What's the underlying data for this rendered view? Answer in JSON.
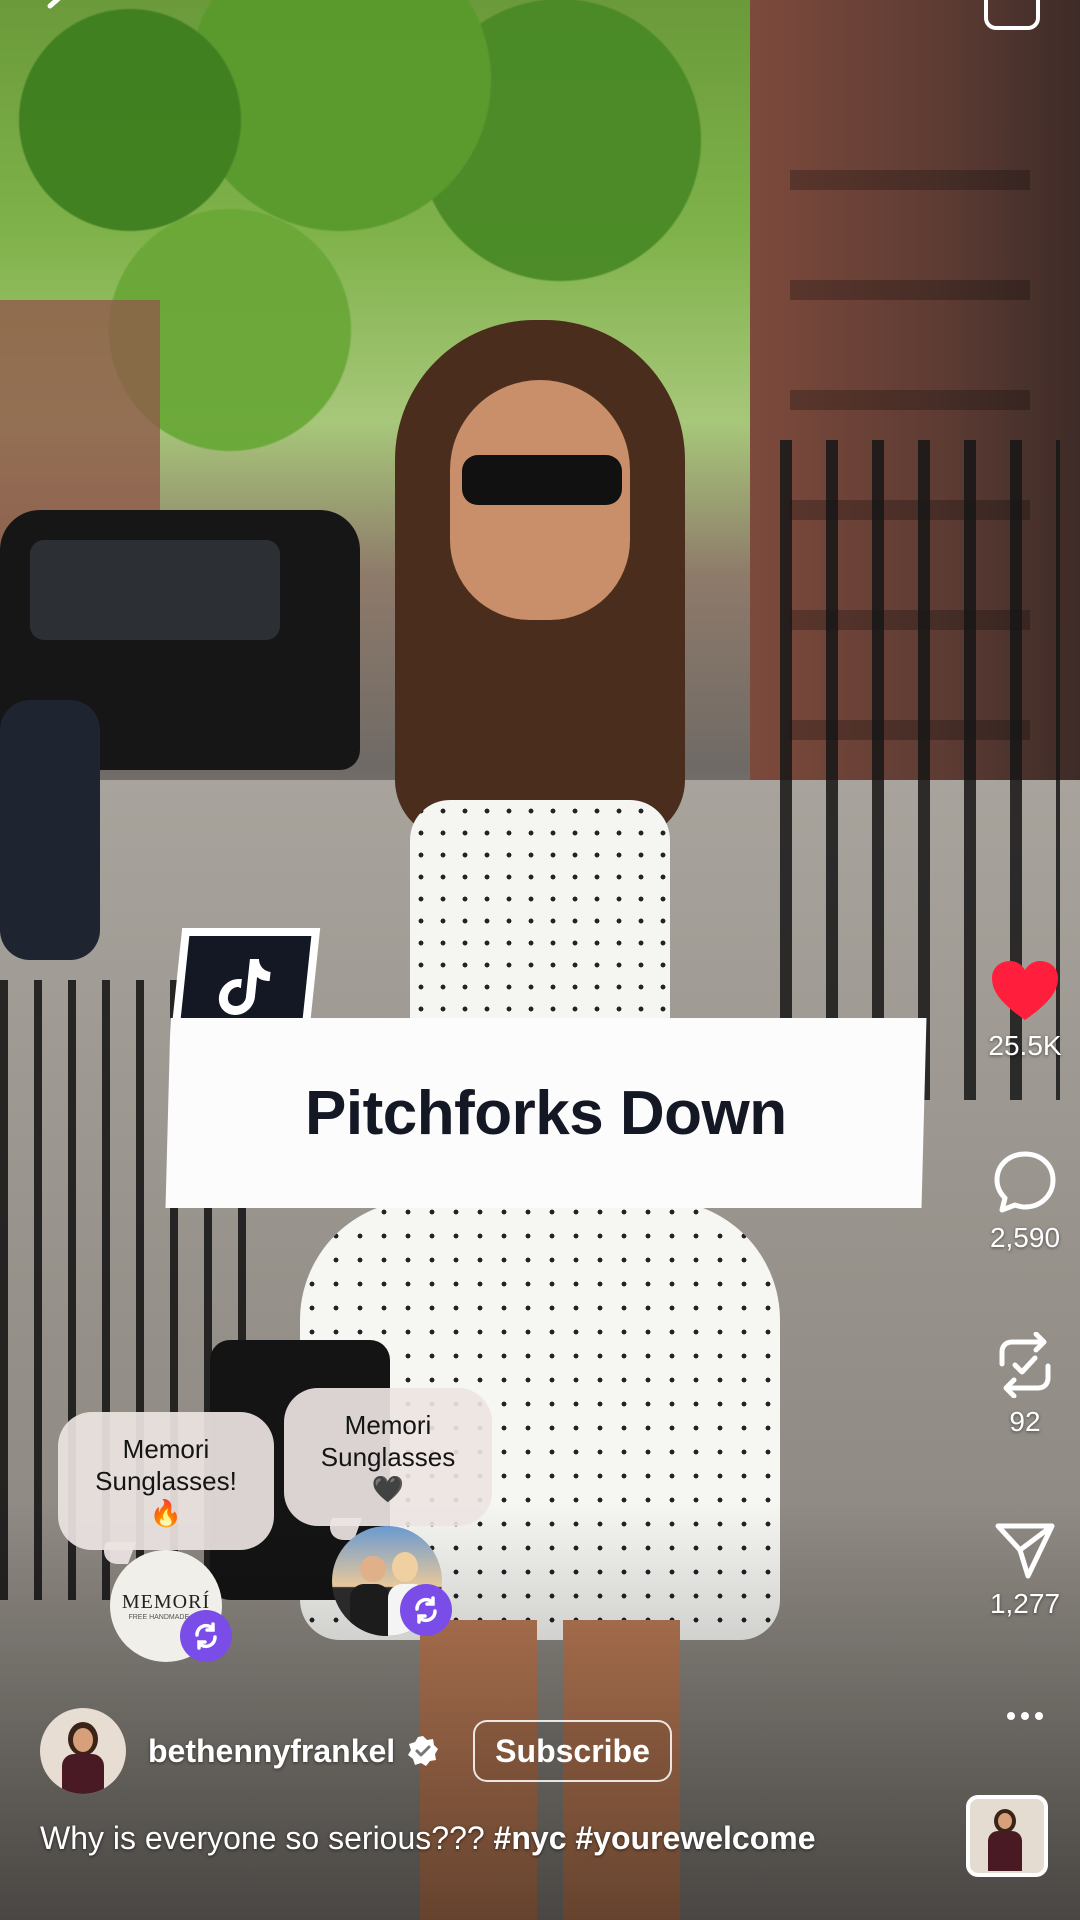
{
  "overlay": {
    "title": "Pitchforks Down"
  },
  "actions": {
    "likes": "25.5K",
    "comments": "2,590",
    "reposts": "92",
    "shares": "1,277",
    "like_color": "#ff1f3d"
  },
  "stickers": [
    {
      "lines": [
        "Memori",
        "Sunglasses!",
        "🔥"
      ],
      "avatar_text": "MEMORÍ",
      "avatar_subtext": "FREE HANDMADE CO."
    },
    {
      "lines": [
        "Memori",
        "Sunglasses",
        "🖤"
      ]
    }
  ],
  "author": {
    "username": "bethennyfrankel",
    "subscribe_label": "Subscribe"
  },
  "caption": {
    "text": "Why is everyone so serious??? ",
    "hashtags": "#nyc #yourewelcome"
  },
  "colors": {
    "title_box": "#fcfcfd",
    "title_text": "#141824",
    "remix_badge": "#7b4de8"
  }
}
